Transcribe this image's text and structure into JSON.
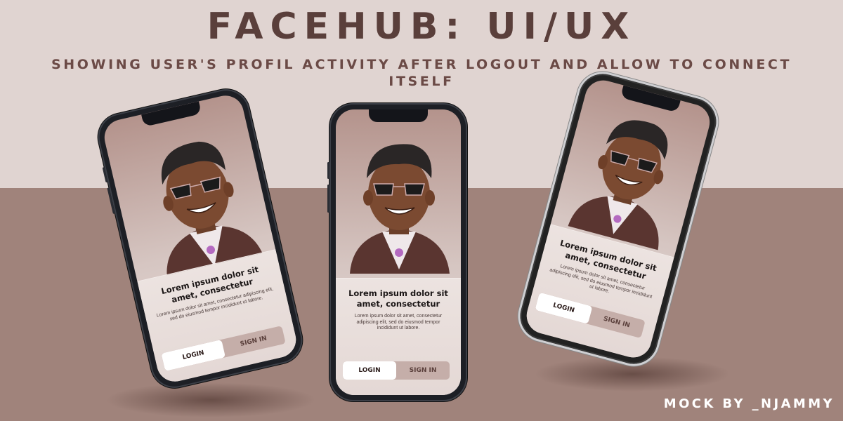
{
  "header": {
    "title": "FACEHUB: UI/UX",
    "subtitle": "SHOWING USER'S PROFIL ACTIVITY AFTER LOGOUT AND ALLOW TO CONNECT ITSELF"
  },
  "footer": {
    "credit": "MOCK BY _NJAMMY"
  },
  "screen": {
    "heading": "Lorem ipsum dolor sit amet, consectetur",
    "body": "Lorem ipsum dolor sit amet, consectetur adipiscing elit, sed do eiusmod tempor incididunt ut labore.",
    "login_label": "LOGIN",
    "signin_label": "SIGN IN"
  },
  "colors": {
    "background_top": "#e0d4d1",
    "background_bottom": "#a0837b",
    "title": "#5a3f3b",
    "button_active": "#ffffff",
    "button_inactive": "#c5aea9"
  },
  "icons": [
    "avatar-illustration",
    "phone-notch"
  ]
}
